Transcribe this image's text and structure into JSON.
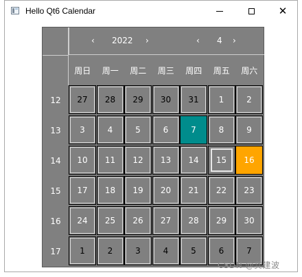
{
  "window": {
    "title": "Hello Qt6 Calendar",
    "controls": {
      "minimize": "—",
      "maximize": "□",
      "close": "✕"
    }
  },
  "calendar": {
    "year": "2022",
    "month": "4",
    "nav": {
      "prev_year": "‹",
      "next_year": "›",
      "prev_month": "‹",
      "next_month": "›"
    },
    "weekdays": [
      "周日",
      "周一",
      "周二",
      "周三",
      "周四",
      "周五",
      "周六"
    ],
    "weeks": [
      {
        "number": "12",
        "days": [
          "27",
          "28",
          "29",
          "30",
          "31",
          "1",
          "2"
        ]
      },
      {
        "number": "13",
        "days": [
          "3",
          "4",
          "5",
          "6",
          "7",
          "8",
          "9"
        ]
      },
      {
        "number": "14",
        "days": [
          "10",
          "11",
          "12",
          "13",
          "14",
          "15",
          "16"
        ]
      },
      {
        "number": "15",
        "days": [
          "17",
          "18",
          "19",
          "20",
          "21",
          "22",
          "23"
        ]
      },
      {
        "number": "16",
        "days": [
          "24",
          "25",
          "26",
          "27",
          "28",
          "29",
          "30"
        ]
      },
      {
        "number": "17",
        "days": [
          "1",
          "2",
          "3",
          "4",
          "5",
          "6",
          "7"
        ]
      }
    ],
    "highlight_color_teal": "#008c8c",
    "highlight_color_orange": "#ffa500"
  },
  "watermark": "CSDN @龚建波"
}
